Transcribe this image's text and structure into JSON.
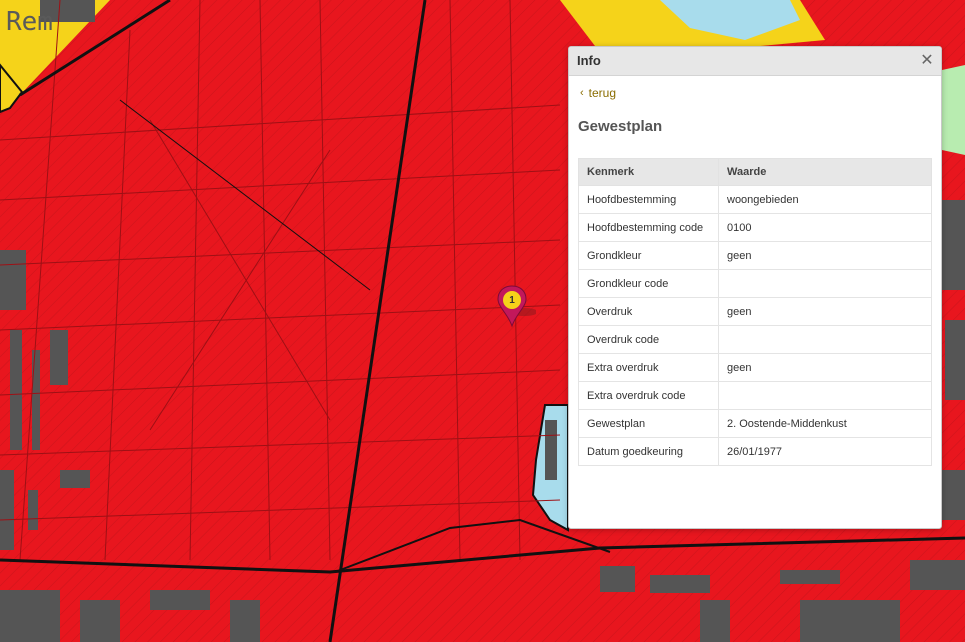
{
  "map": {
    "colors": {
      "residential": "#e8161e",
      "building": "#555555",
      "yellow_zone": "#f5d31a",
      "blue_zone": "#a8dcec",
      "green_zone": "#b8ecb0",
      "road": "#111111"
    },
    "corner_label": "Rem",
    "marker_number": "1"
  },
  "panel": {
    "title": "Info",
    "close_icon": "close-icon",
    "back_label": "terug",
    "heading": "Gewestplan",
    "table": {
      "headers": [
        "Kenmerk",
        "Waarde"
      ],
      "rows": [
        {
          "key": "Hoofdbestemming",
          "value": "woongebieden"
        },
        {
          "key": "Hoofdbestemming code",
          "value": "0100"
        },
        {
          "key": "Grondkleur",
          "value": "geen"
        },
        {
          "key": "Grondkleur code",
          "value": ""
        },
        {
          "key": "Overdruk",
          "value": "geen"
        },
        {
          "key": "Overdruk code",
          "value": ""
        },
        {
          "key": "Extra overdruk",
          "value": "geen"
        },
        {
          "key": "Extra overdruk code",
          "value": ""
        },
        {
          "key": "Gewestplan",
          "value": "2. Oostende-Middenkust"
        },
        {
          "key": "Datum goedkeuring",
          "value": "26/01/1977"
        }
      ]
    }
  }
}
